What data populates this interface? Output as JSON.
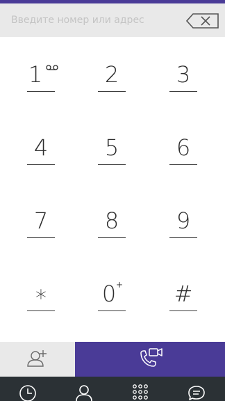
{
  "input": {
    "placeholder": "Введите номер или адрес"
  },
  "keys": [
    {
      "digit": "1",
      "sub": "voicemail"
    },
    {
      "digit": "2"
    },
    {
      "digit": "3"
    },
    {
      "digit": "4"
    },
    {
      "digit": "5"
    },
    {
      "digit": "6"
    },
    {
      "digit": "7"
    },
    {
      "digit": "8"
    },
    {
      "digit": "9"
    },
    {
      "digit": "*"
    },
    {
      "digit": "0",
      "sub": "+"
    },
    {
      "digit": "#"
    }
  ],
  "icons": {
    "backspace": "backspace-icon",
    "add_contact": "add-contact-icon",
    "call": "video-call-icon",
    "nav": [
      "history-icon",
      "contacts-icon",
      "dialpad-icon",
      "chat-icon"
    ]
  },
  "colors": {
    "accent": "#4a3b97",
    "input_bg": "#e9e9e9",
    "bottom_bar": "#2b3135"
  }
}
